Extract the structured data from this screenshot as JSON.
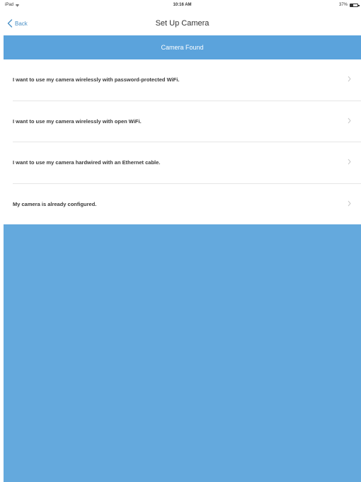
{
  "status_bar": {
    "left": "iPad",
    "time": "10:16 AM",
    "battery": "37%"
  },
  "nav": {
    "back_label": "Back",
    "title": "Set Up Camera"
  },
  "banner": {
    "text": "Camera Found"
  },
  "options": [
    {
      "label": "I want to use my camera wirelessly with password-protected WiFi."
    },
    {
      "label": "I want to use my camera wirelessly with open WiFi."
    },
    {
      "label": "I want to use my camera hardwired with an Ethernet cable."
    },
    {
      "label": "My camera is already configured."
    }
  ],
  "colors": {
    "accent": "#5ba3dc",
    "back_link": "#4a90c6",
    "background_fill": "#64a9dd"
  },
  "icons": {
    "back": "chevron-left-icon",
    "row": "chevron-right-icon",
    "wifi": "wifi-icon",
    "battery": "battery-icon"
  }
}
